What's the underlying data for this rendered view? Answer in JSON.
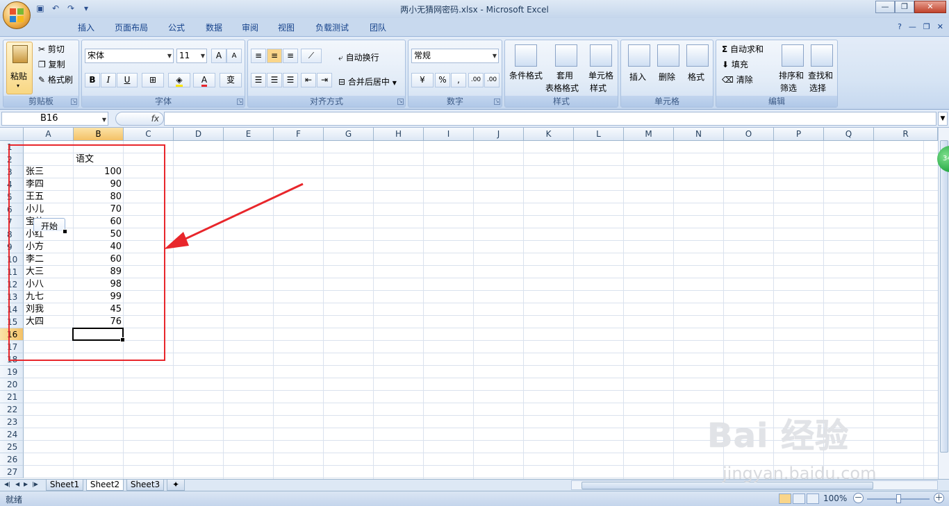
{
  "window": {
    "title": "两小无猜网密码.xlsx - Microsoft Excel",
    "controls": [
      "—",
      "❐",
      "✕"
    ]
  },
  "tabs": [
    "开始",
    "插入",
    "页面布局",
    "公式",
    "数据",
    "审阅",
    "视图",
    "负载测试",
    "团队"
  ],
  "ribbon": {
    "clipboard": {
      "paste": "粘贴",
      "cut": "剪切",
      "copy": "复制",
      "format_painter": "格式刷",
      "label": "剪贴板"
    },
    "font": {
      "name": "宋体",
      "size": "11",
      "label": "字体",
      "bold": "B",
      "italic": "I",
      "underline": "U",
      "grow": "A",
      "shrink": "A",
      "font_color": "A",
      "phonetic": "变"
    },
    "alignment": {
      "wrap": "自动换行",
      "merge": "合并后居中",
      "label": "对齐方式"
    },
    "number": {
      "format": "常规",
      "percent": "%",
      "comma": ",",
      "inc_decimal": ".00",
      "dec_decimal": ".00",
      "label": "数字"
    },
    "styles": {
      "conditional": "条件格式",
      "table_l1": "套用",
      "table_l2": "表格格式",
      "cell_l1": "单元格",
      "cell_l2": "样式",
      "label": "样式"
    },
    "cells": {
      "insert": "插入",
      "delete": "删除",
      "format": "格式",
      "label": "单元格"
    },
    "editing": {
      "autosum": "自动求和",
      "fill": "填充",
      "clear": "清除",
      "sort_l1": "排序和",
      "sort_l2": "筛选",
      "find_l1": "查找和",
      "find_l2": "选择",
      "label": "编辑"
    }
  },
  "formula_bar": {
    "name_box": "B16",
    "fx": "fx",
    "formula": ""
  },
  "columns": [
    "A",
    "B",
    "C",
    "D",
    "E",
    "F",
    "G",
    "H",
    "I",
    "J",
    "K",
    "L",
    "M",
    "N",
    "O",
    "P",
    "Q",
    "R"
  ],
  "selected_col": "B",
  "rows": [
    "1",
    "2",
    "3",
    "4",
    "5",
    "6",
    "7",
    "8",
    "9",
    "10",
    "11",
    "12",
    "13",
    "14",
    "15",
    "16",
    "17",
    "18",
    "19",
    "20",
    "21",
    "22",
    "23",
    "24",
    "25",
    "26",
    "27"
  ],
  "selected_row": "16",
  "header_cell": "语文",
  "names": [
    "张三",
    "李四",
    "王五",
    "小儿",
    "宝儿",
    "小红",
    "小方",
    "李二",
    "大三",
    "小八",
    "九七",
    "刘我",
    "大四"
  ],
  "scores": [
    "100",
    "90",
    "80",
    "70",
    "60",
    "50",
    "40",
    "60",
    "89",
    "98",
    "99",
    "45",
    "76"
  ],
  "sheets": [
    "Sheet1",
    "Sheet2",
    "Sheet3"
  ],
  "active_sheet": "Sheet2",
  "status": {
    "ready": "就绪",
    "zoom": "100%",
    "zoom_minus": "－",
    "zoom_plus": "＋"
  },
  "watermark": {
    "brand": "Bai 经验",
    "url": "jingyan.baidu.com"
  },
  "badge": "34",
  "colors": {
    "annotation": "#e8262b",
    "ribbon": "#d6e4f4",
    "selected_header": "#f4c166"
  }
}
